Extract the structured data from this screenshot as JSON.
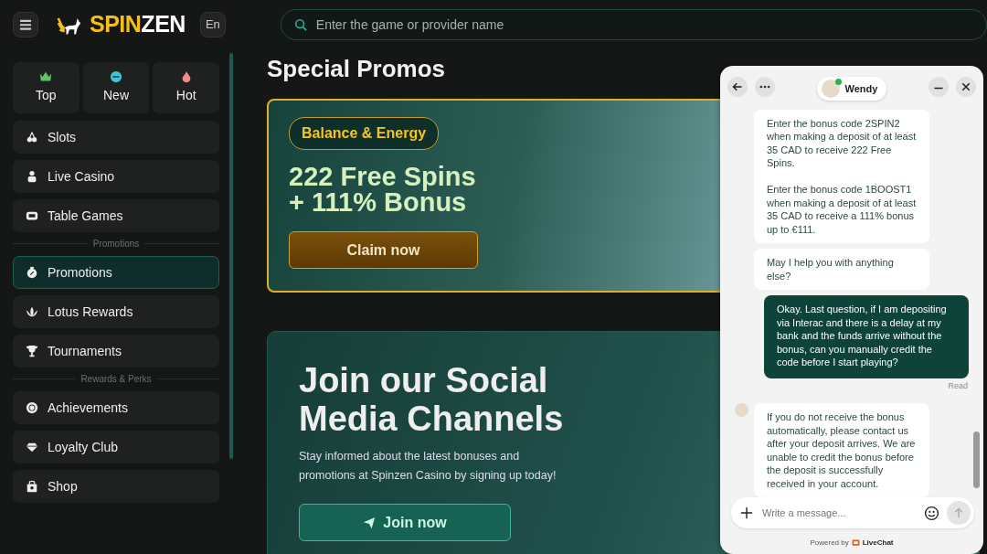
{
  "header": {
    "logo": {
      "part_1": "SPIN",
      "part_2": "ZEN"
    },
    "language": "En",
    "search": {
      "placeholder": "Enter the game or provider name"
    }
  },
  "sidebar": {
    "quick_tabs": [
      {
        "kind": "crown",
        "label": "Top"
      },
      {
        "kind": "new",
        "label": "New"
      },
      {
        "kind": "flame",
        "label": "Hot"
      }
    ],
    "items": [
      {
        "kind": "item",
        "label": "Slots",
        "selected": false
      },
      {
        "kind": "item",
        "label": "Live Casino",
        "selected": false
      },
      {
        "kind": "item",
        "label": "Table Games",
        "selected": false
      },
      {
        "kind": "section",
        "label": "Promotions"
      },
      {
        "kind": "item",
        "label": "Promotions",
        "selected": true
      },
      {
        "kind": "item",
        "label": "Lotus Rewards",
        "selected": false
      },
      {
        "kind": "item",
        "label": "Tournaments",
        "selected": false
      },
      {
        "kind": "section",
        "label": "Rewards & Perks"
      },
      {
        "kind": "item",
        "label": "Achievements",
        "selected": false
      },
      {
        "kind": "item",
        "label": "Loyalty Club",
        "selected": false
      },
      {
        "kind": "item",
        "label": "Shop",
        "selected": false
      }
    ]
  },
  "main": {
    "title": "Special Promos",
    "promos": [
      {
        "kind": "bonus",
        "tag": "Balance & Energy",
        "title_lines": [
          "222 Free Spins",
          "+ 111% Bonus"
        ],
        "button": "Claim now"
      },
      {
        "kind": "social",
        "title": "Join our Social Media Channels",
        "description": "Stay informed about the latest bonuses and promotions at Spinzen Casino by signing up today!",
        "button": "Join now"
      }
    ]
  },
  "chat": {
    "agent": {
      "name": "Wendy",
      "online": true
    },
    "messages": [
      {
        "kind": "agent",
        "avatar": false,
        "text": "Enter the bonus code 2SPIN2 when making a deposit of at least 35 CAD to receive 222 Free Spins.\n\nEnter the bonus code 1BOOST1 when making a deposit of at least 35 CAD to receive a 111% bonus up to €111."
      },
      {
        "kind": "agent",
        "avatar": false,
        "text": "May I help you with anything else?"
      },
      {
        "kind": "user",
        "text": "Okay. Last question, if I am depositing via Interac and there is a delay at my bank and the funds arrive without the bonus, can you manually credit the code before I start playing?",
        "status": "Read"
      },
      {
        "kind": "agent",
        "avatar": true,
        "text": "If you do not receive the bonus automatically, please contact us after your deposit arrives. We are unable to credit the bonus before the deposit is successfully received in your account."
      }
    ],
    "input": {
      "placeholder": "Write a message..."
    },
    "footer": {
      "prefix": "Powered by",
      "brand": "LiveChat"
    }
  }
}
